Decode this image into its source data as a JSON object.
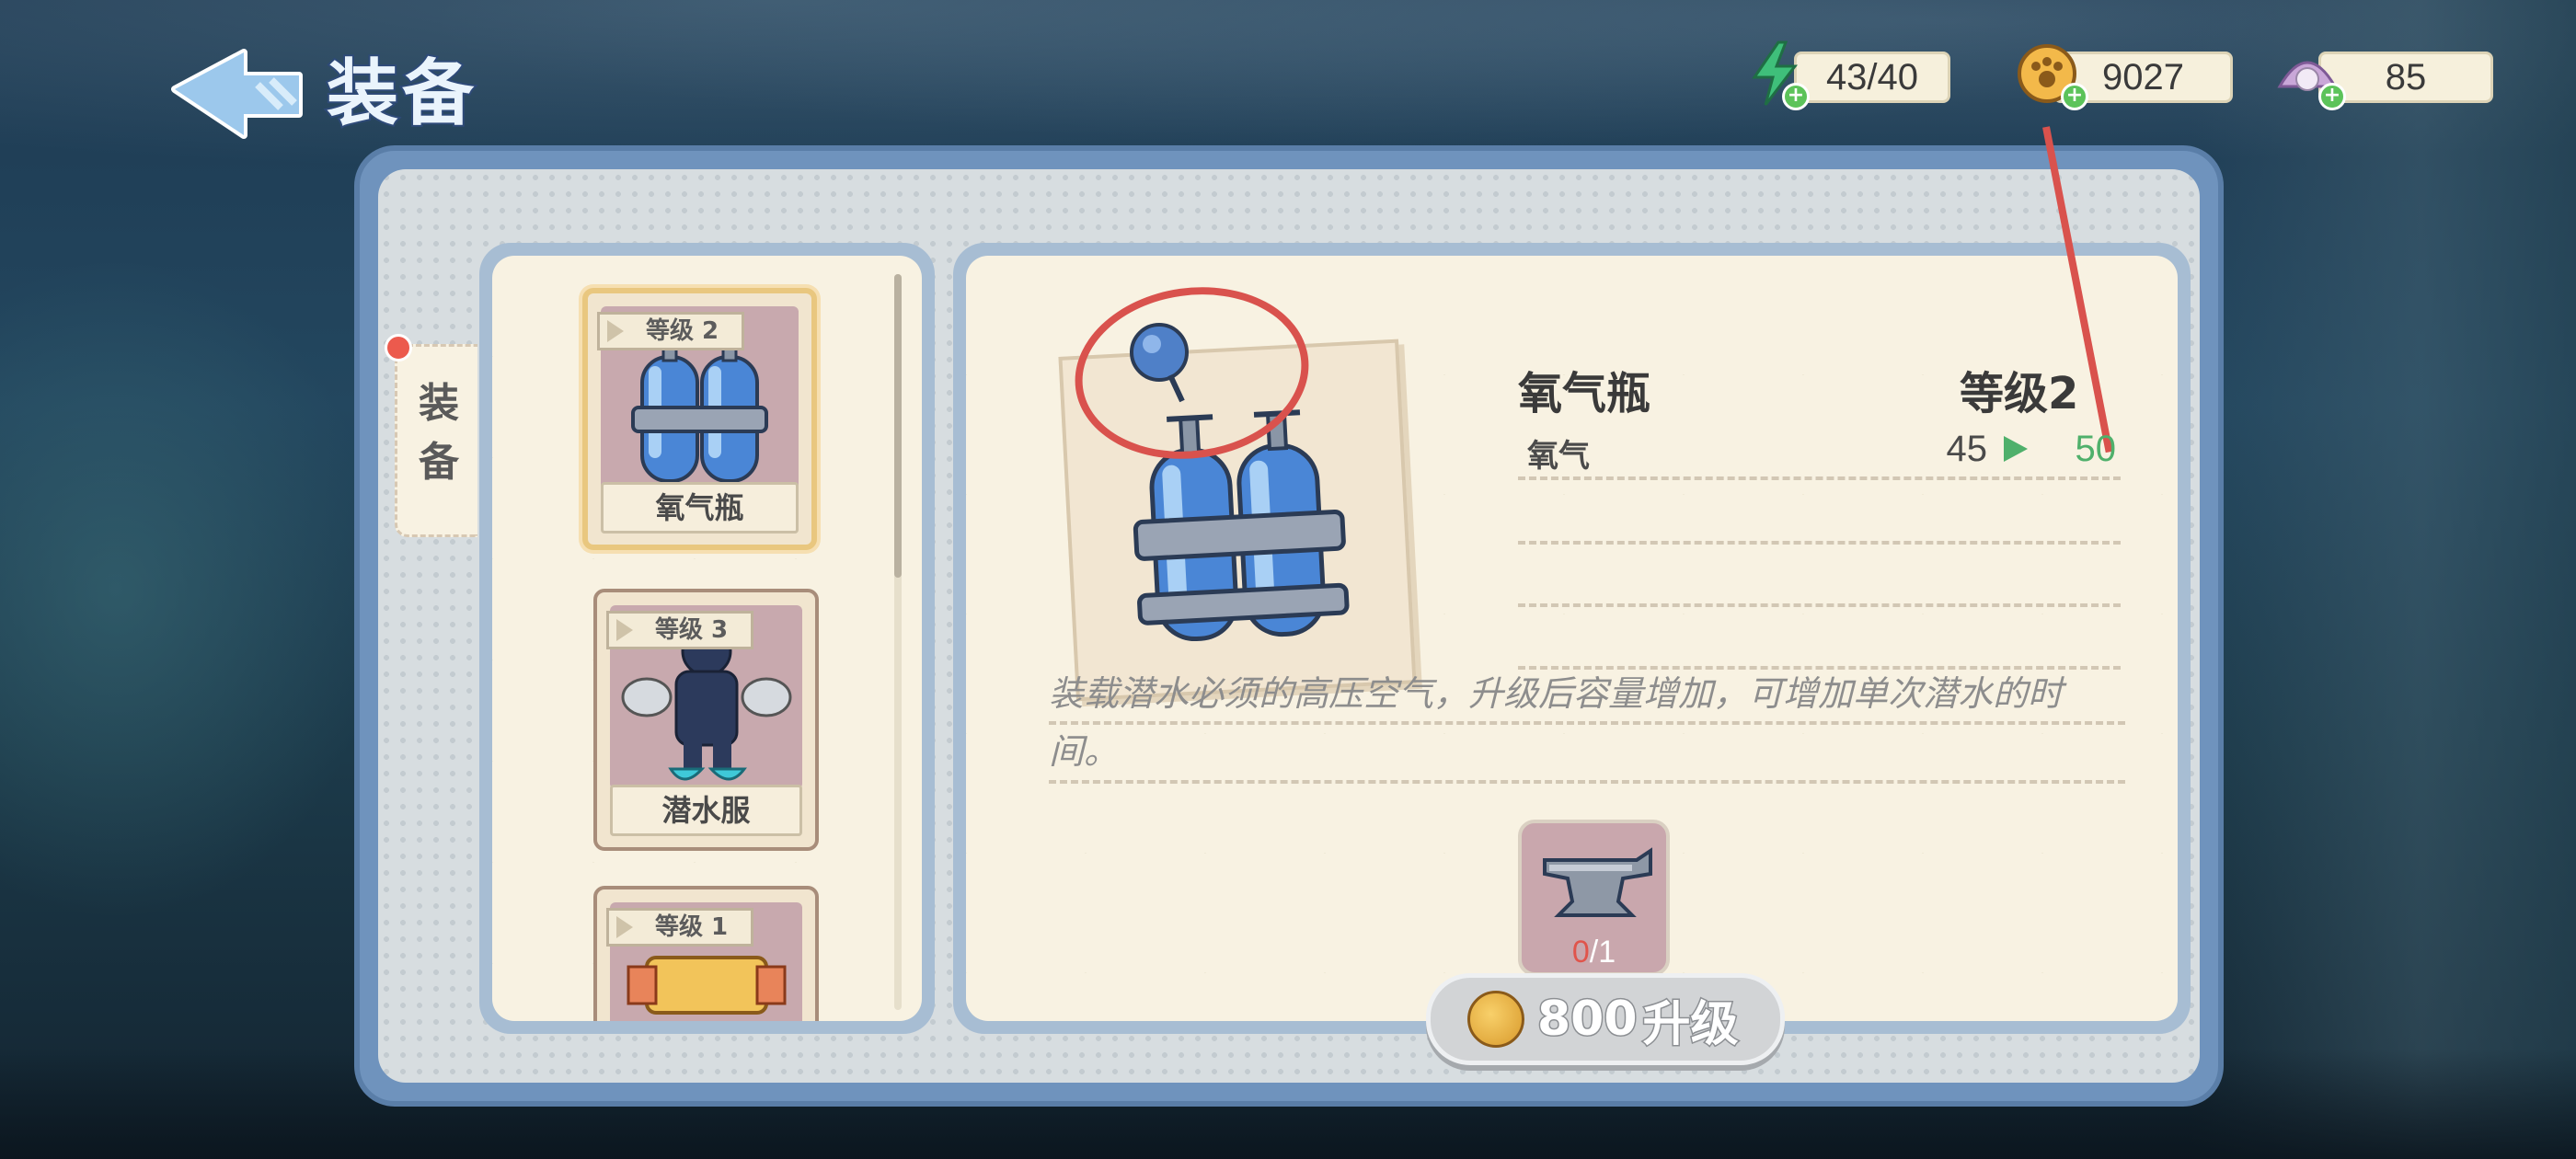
{
  "header": {
    "title": "装备",
    "resources": [
      {
        "name": "energy",
        "icon": "lightning-icon",
        "value": "43/40"
      },
      {
        "name": "coins",
        "icon": "paw-coin-icon",
        "value": "9027"
      },
      {
        "name": "pearls",
        "icon": "pearl-shell-icon",
        "value": "85"
      }
    ]
  },
  "side_tab": {
    "label_line1": "装",
    "label_line2": "备"
  },
  "items": [
    {
      "level": "等级 2",
      "name": "氧气瓶",
      "icon": "oxygen-tank-icon",
      "selected": true
    },
    {
      "level": "等级 3",
      "name": "潜水服",
      "icon": "diving-suit-icon",
      "selected": false
    },
    {
      "level": "等级 1",
      "name": "",
      "icon": "partial-item-icon",
      "selected": false
    }
  ],
  "detail": {
    "name": "氧气瓶",
    "level": "等级2",
    "stats": [
      {
        "label": "氧气",
        "current": "45",
        "next": "50"
      }
    ],
    "description": "装载潜水必须的高压空气，升级后容量增加，可增加单次潜水的时间。",
    "material": {
      "have": "0",
      "need": "/1",
      "icon": "anvil-icon"
    },
    "upgrade_button": {
      "cost": "800",
      "label": "升级"
    }
  },
  "colors": {
    "panel_blue": "#6f93bd",
    "card_cream": "#f8f2e2",
    "stat_green": "#4fb06b",
    "annotation_red": "#d9524d"
  }
}
